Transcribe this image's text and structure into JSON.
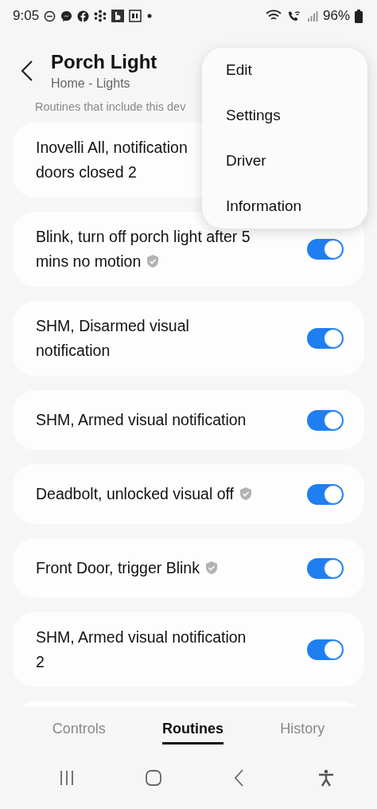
{
  "status_bar": {
    "time": "9:05",
    "battery": "96%"
  },
  "header": {
    "title": "Porch Light",
    "subtitle": "Home - Lights"
  },
  "section_label": "Routines that include this dev",
  "routines": [
    {
      "lines": [
        "Inovelli All, notification",
        "doors closed 2"
      ],
      "verified": false
    },
    {
      "lines": [
        "Blink, turn off porch light after 5",
        "mins no motion"
      ],
      "verified": true,
      "on": true
    },
    {
      "lines": [
        "SHM, Disarmed visual",
        "notification"
      ],
      "verified": false,
      "on": true
    },
    {
      "lines": [
        "SHM, Armed visual notification"
      ],
      "verified": false,
      "on": true
    },
    {
      "lines": [
        "Deadbolt, unlocked visual off"
      ],
      "verified": true,
      "on": true
    },
    {
      "lines": [
        "Front Door, trigger Blink"
      ],
      "verified": true,
      "on": true
    },
    {
      "lines": [
        "SHM, Armed visual notification",
        "2"
      ],
      "verified": false,
      "on": true
    }
  ],
  "menu": [
    "Edit",
    "Settings",
    "Driver",
    "Information"
  ],
  "tabs": [
    {
      "label": "Controls",
      "selected": false
    },
    {
      "label": "Routines",
      "selected": true
    },
    {
      "label": "History",
      "selected": false
    }
  ]
}
